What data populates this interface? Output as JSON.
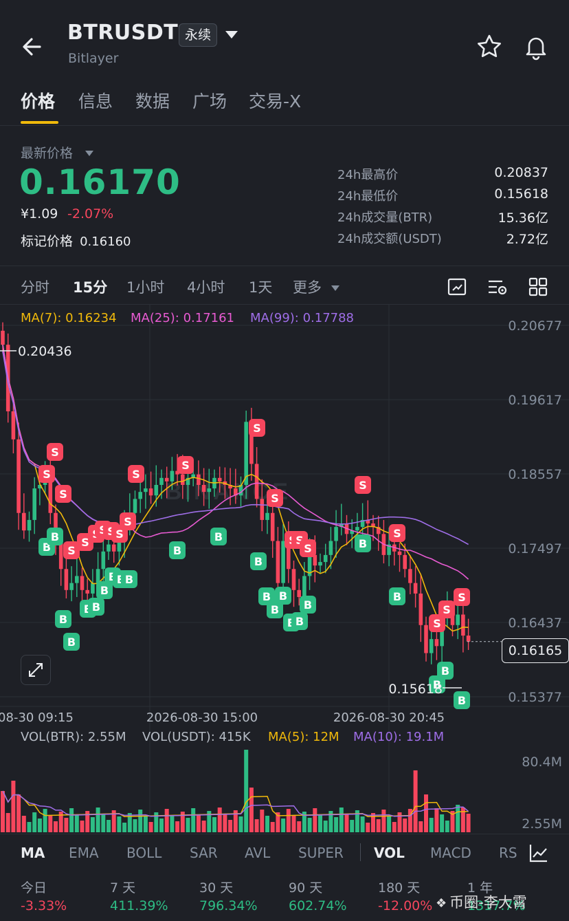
{
  "header": {
    "pair": "BTRUSDT",
    "contract_badge": "永续",
    "subtitle": "Bitlayer"
  },
  "tabs": [
    "价格",
    "信息",
    "数据",
    "广场",
    "交易-X"
  ],
  "price": {
    "latest_label": "最新价格",
    "last": "0.16170",
    "cny": "¥1.09",
    "change_pct": "-2.07%",
    "mark_label": "标记价格",
    "mark": "0.16160"
  },
  "stats": [
    {
      "label": "24h最高价",
      "value": "0.20837"
    },
    {
      "label": "24h最低价",
      "value": "0.15618"
    },
    {
      "label": "24h成交量(BTR)",
      "value": "15.36亿"
    },
    {
      "label": "24h成交额(USDT)",
      "value": "2.72亿"
    }
  ],
  "intervals": [
    "分时",
    "15分",
    "1小时",
    "4小时",
    "1天",
    "更多"
  ],
  "intervals_active": "15分",
  "ma_legend": {
    "ma7": "MA(7): 0.16234",
    "ma25": "MA(25): 0.17161",
    "ma99": "MA(99): 0.17788"
  },
  "chart_data": {
    "type": "candlestick",
    "price_axis": [
      "0.20677",
      "0.19617",
      "0.18557",
      "0.17497",
      "0.16437",
      "0.15377"
    ],
    "time_axis": [
      "08-30 09:15",
      "2026-08-30 15:00",
      "2026-08-30 20:45"
    ],
    "high_marker": "0.20436",
    "low_marker": "0.15618",
    "current_price": "0.16165",
    "colors": {
      "up": "#2ebd85",
      "down": "#f6465d",
      "ma7": "#f0b90b",
      "ma25": "#e85bd2",
      "ma99": "#9f6ee8"
    },
    "watermark": "BINANCE"
  },
  "volume": {
    "legend": {
      "vol_btr": "VOL(BTR): 2.55M",
      "vol_usdt": "VOL(USDT): 415K",
      "ma5": "MA(5): 12M",
      "ma10": "MA(10): 19.1M"
    },
    "axis": [
      "80.4M",
      "2.55M"
    ]
  },
  "indicators": [
    "MA",
    "EMA",
    "BOLL",
    "SAR",
    "AVL",
    "SUPER",
    "VOL",
    "MACD",
    "RS"
  ],
  "performance": [
    {
      "label": "今日",
      "value": "-3.33%"
    },
    {
      "label": "7 天",
      "value": "411.39%"
    },
    {
      "label": "30 天",
      "value": "796.34%"
    },
    {
      "label": "90 天",
      "value": "602.74%"
    },
    {
      "label": "180 天",
      "value": "-12.00%"
    },
    {
      "label": "1 年",
      "value": "1317.7%"
    }
  ],
  "watermark_user": "币圈-李大霄"
}
